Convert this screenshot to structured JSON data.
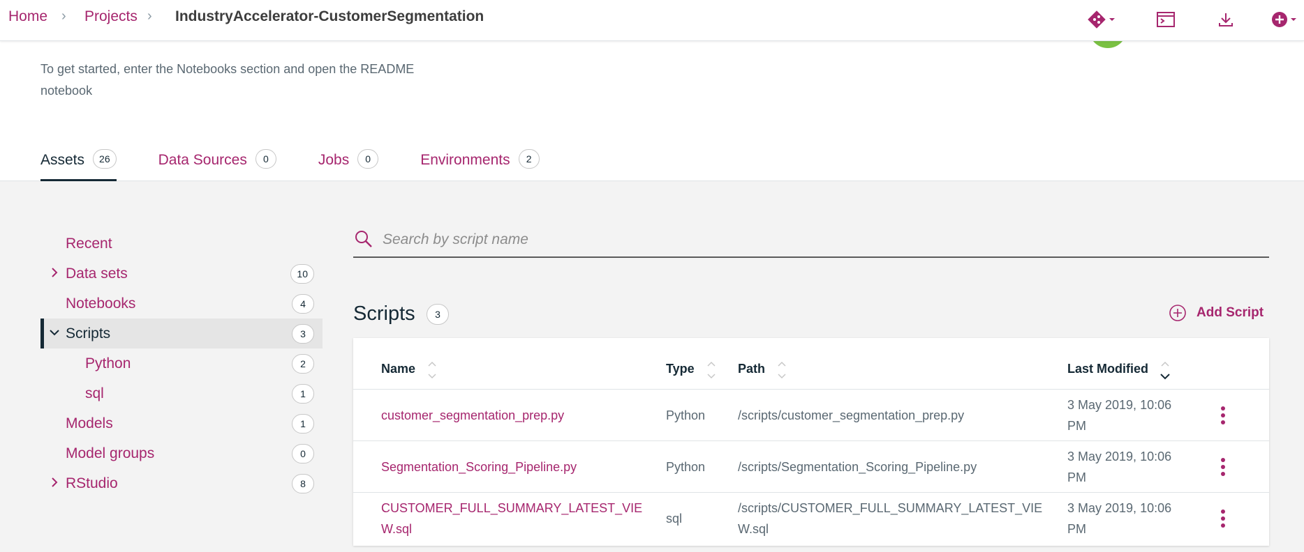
{
  "breadcrumb": {
    "home": "Home",
    "projects": "Projects",
    "current": "IndustryAccelerator-CustomerSegmentation"
  },
  "project": {
    "description": "To get started, enter the Notebooks section and open the README notebook"
  },
  "tabs": [
    {
      "label": "Assets",
      "count": "26"
    },
    {
      "label": "Data Sources",
      "count": "0"
    },
    {
      "label": "Jobs",
      "count": "0"
    },
    {
      "label": "Environments",
      "count": "2"
    }
  ],
  "sidebar": {
    "items": [
      {
        "label": "Recent",
        "count": ""
      },
      {
        "label": "Data sets",
        "count": "10"
      },
      {
        "label": "Notebooks",
        "count": "4"
      },
      {
        "label": "Scripts",
        "count": "3"
      },
      {
        "label": "Python",
        "count": "2"
      },
      {
        "label": "sql",
        "count": "1"
      },
      {
        "label": "Models",
        "count": "1"
      },
      {
        "label": "Model groups",
        "count": "0"
      },
      {
        "label": "RStudio",
        "count": "8"
      }
    ]
  },
  "search": {
    "placeholder": "Search by script name"
  },
  "scripts": {
    "title": "Scripts",
    "count": "3",
    "add_label": "Add Script",
    "columns": {
      "name": "Name",
      "type": "Type",
      "path": "Path",
      "modified": "Last Modified"
    },
    "rows": [
      {
        "name": "customer_segmentation_prep.py",
        "type": "Python",
        "path": "/scripts/customer_segmentation_prep.py",
        "modified": "3 May 2019, 10:06 PM"
      },
      {
        "name": "Segmentation_Scoring_Pipeline.py",
        "type": "Python",
        "path": "/scripts/Segmentation_Scoring_Pipeline.py",
        "modified": "3 May 2019, 10:06 PM"
      },
      {
        "name": "CUSTOMER_FULL_SUMMARY_LATEST_VIEW.sql",
        "type": "sql",
        "path": "/scripts/CUSTOMER_FULL_SUMMARY_LATEST_VIEW.sql",
        "modified": "3 May 2019, 10:06 PM"
      }
    ]
  },
  "colors": {
    "brand": "#a6266e",
    "text": "#152935",
    "avatar": "#7ac143"
  },
  "icons": [
    "git-icon",
    "terminal-icon",
    "download-icon",
    "add-circle-icon",
    "search-icon",
    "chevron-right-icon",
    "chevron-down-icon",
    "sort-icon",
    "overflow-menu-icon"
  ]
}
